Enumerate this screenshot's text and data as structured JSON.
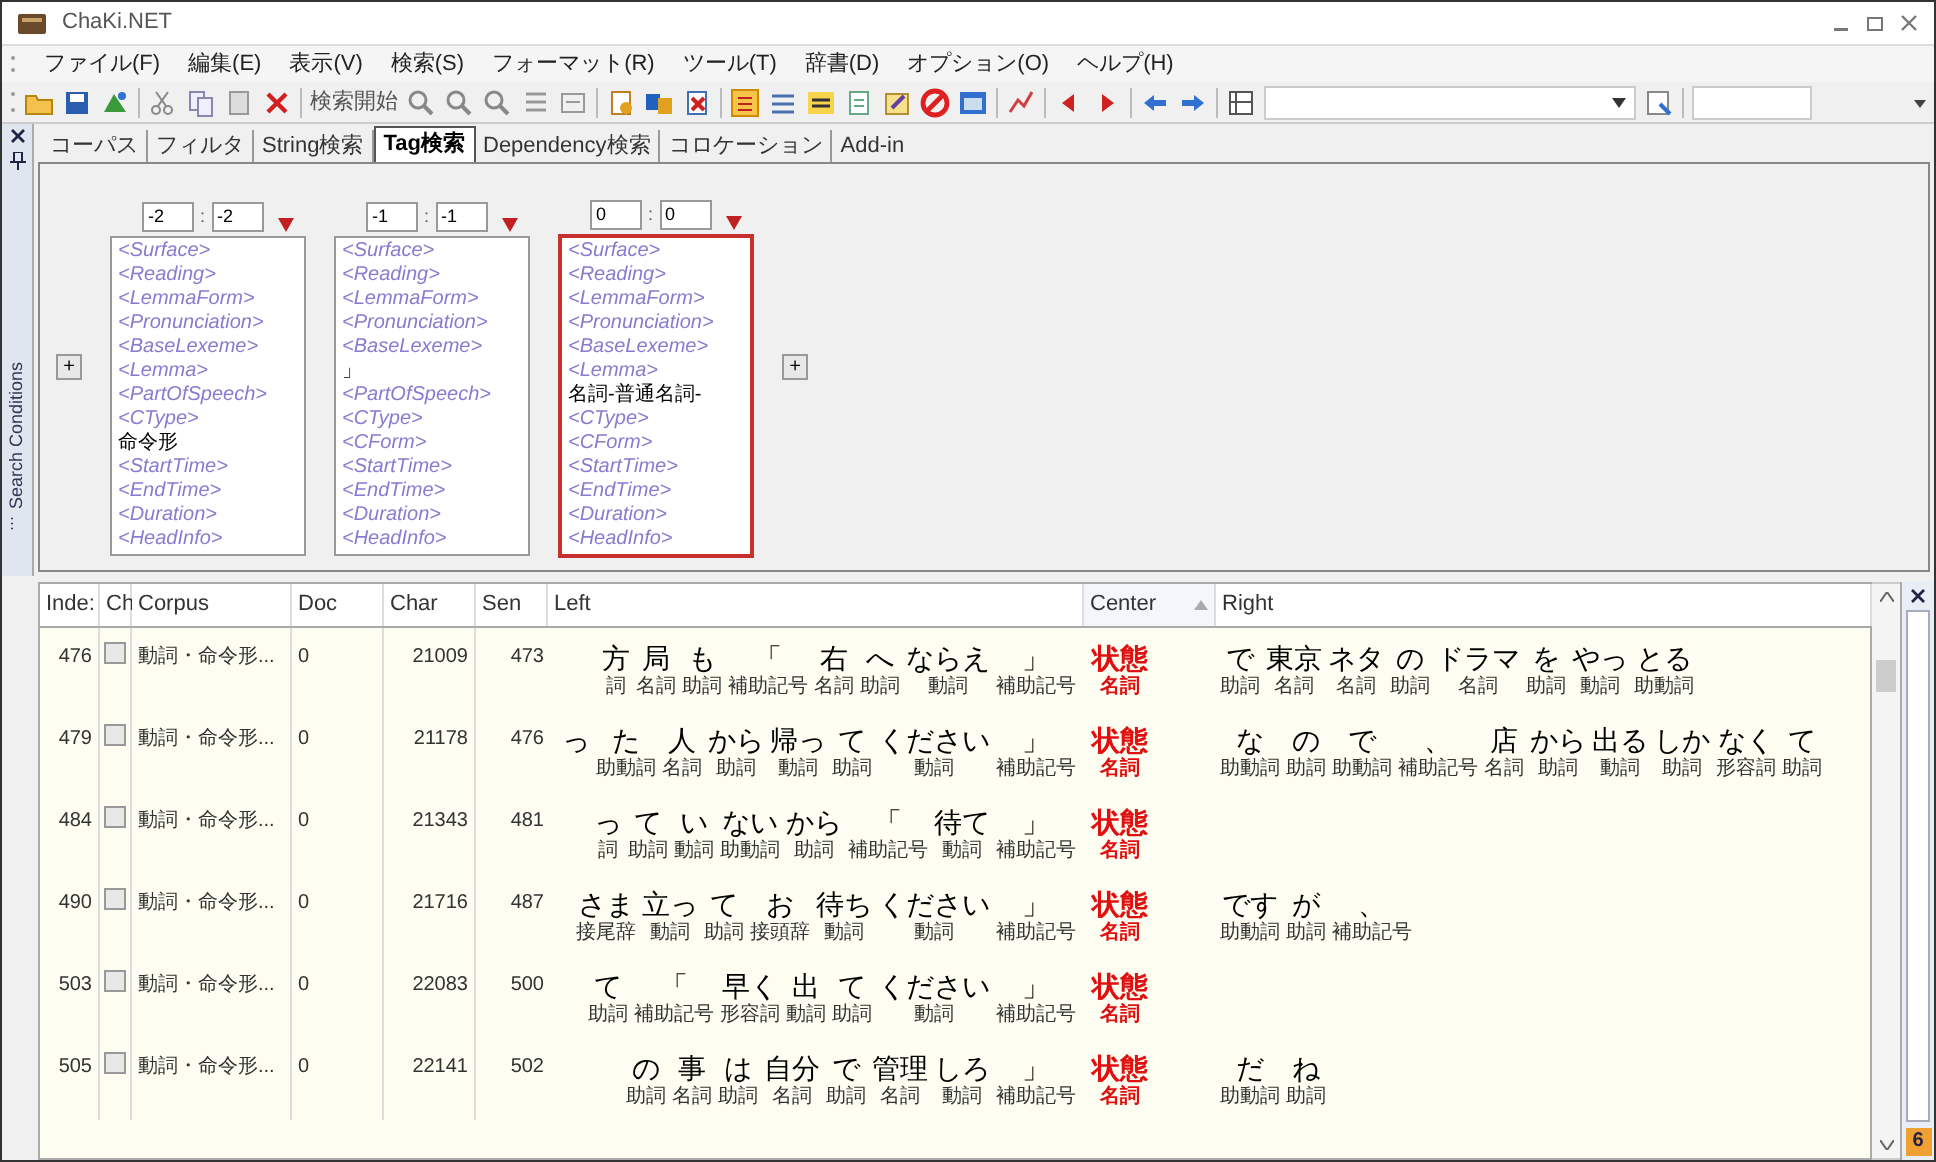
{
  "window": {
    "title": "ChaKi.NET"
  },
  "menu": [
    "ファイル(F)",
    "編集(E)",
    "表示(V)",
    "検索(S)",
    "フォーマット(R)",
    "ツール(T)",
    "辞書(D)",
    "オプション(O)",
    "ヘルプ(H)"
  ],
  "toolbar": {
    "search_button": "検索開始"
  },
  "side_tab": {
    "label": "Search Conditions",
    "more": "..."
  },
  "tabs": [
    {
      "label": "コーパス",
      "selected": false
    },
    {
      "label": "フィルタ",
      "selected": false
    },
    {
      "label": "String検索",
      "selected": false
    },
    {
      "label": "Tag検索",
      "selected": true
    },
    {
      "label": "Dependency検索",
      "selected": false
    },
    {
      "label": "コロケーション",
      "selected": false
    },
    {
      "label": "Add-in",
      "selected": false
    }
  ],
  "search_conditions": {
    "add_button": "+",
    "boxes": [
      {
        "range_from": "-2",
        "separator": ":",
        "range_to": "-2",
        "selected": false,
        "fields": [
          {
            "placeholder": "<Surface>"
          },
          {
            "placeholder": "<Reading>"
          },
          {
            "placeholder": "<LemmaForm>"
          },
          {
            "placeholder": "<Pronunciation>"
          },
          {
            "placeholder": "<BaseLexeme>"
          },
          {
            "placeholder": "<Lemma>"
          },
          {
            "placeholder": "<PartOfSpeech>"
          },
          {
            "placeholder": "<CType>"
          },
          {
            "value": "命令形"
          },
          {
            "placeholder": "<StartTime>"
          },
          {
            "placeholder": "<EndTime>"
          },
          {
            "placeholder": "<Duration>"
          },
          {
            "placeholder": "<HeadInfo>"
          }
        ]
      },
      {
        "range_from": "-1",
        "separator": ":",
        "range_to": "-1",
        "selected": false,
        "fields": [
          {
            "placeholder": "<Surface>"
          },
          {
            "placeholder": "<Reading>"
          },
          {
            "placeholder": "<LemmaForm>"
          },
          {
            "placeholder": "<Pronunciation>"
          },
          {
            "placeholder": "<BaseLexeme>"
          },
          {
            "value": "」"
          },
          {
            "placeholder": "<PartOfSpeech>"
          },
          {
            "placeholder": "<CType>"
          },
          {
            "placeholder": "<CForm>"
          },
          {
            "placeholder": "<StartTime>"
          },
          {
            "placeholder": "<EndTime>"
          },
          {
            "placeholder": "<Duration>"
          },
          {
            "placeholder": "<HeadInfo>"
          }
        ]
      },
      {
        "range_from": "0",
        "separator": ":",
        "range_to": "0",
        "selected": true,
        "fields": [
          {
            "placeholder": "<Surface>"
          },
          {
            "placeholder": "<Reading>"
          },
          {
            "placeholder": "<LemmaForm>"
          },
          {
            "placeholder": "<Pronunciation>"
          },
          {
            "placeholder": "<BaseLexeme>"
          },
          {
            "placeholder": "<Lemma>"
          },
          {
            "value": "名詞-普通名詞-"
          },
          {
            "placeholder": "<CType>"
          },
          {
            "placeholder": "<CForm>"
          },
          {
            "placeholder": "<StartTime>"
          },
          {
            "placeholder": "<EndTime>"
          },
          {
            "placeholder": "<Duration>"
          },
          {
            "placeholder": "<HeadInfo>"
          }
        ]
      }
    ]
  },
  "results": {
    "columns": [
      {
        "label": "Inde:",
        "sorted": false
      },
      {
        "label": "Ch",
        "sorted": false
      },
      {
        "label": "Corpus",
        "sorted": false
      },
      {
        "label": "Doc",
        "sorted": false
      },
      {
        "label": "Char",
        "sorted": false
      },
      {
        "label": "Sen",
        "sorted": false
      },
      {
        "label": "Left",
        "sorted": false
      },
      {
        "label": "Center",
        "sorted": true
      },
      {
        "label": "Right",
        "sorted": false
      }
    ],
    "rows": [
      {
        "index": "476",
        "checked": false,
        "corpus": "動詞・命令形...",
        "doc": "0",
        "char": "21009",
        "sen": "473",
        "left": [
          {
            "surface": "方",
            "pos": "詞"
          },
          {
            "surface": "局",
            "pos": "名詞"
          },
          {
            "surface": "も",
            "pos": "助詞"
          },
          {
            "surface": "「",
            "pos": "補助記号"
          },
          {
            "surface": "右",
            "pos": "名詞"
          },
          {
            "surface": "へ",
            "pos": "助詞"
          },
          {
            "surface": "ならえ",
            "pos": "動詞"
          },
          {
            "surface": "」",
            "pos": "補助記号"
          }
        ],
        "center": {
          "surface": "状態",
          "pos": "名詞"
        },
        "right": [
          {
            "surface": "で",
            "pos": "助詞"
          },
          {
            "surface": "東京",
            "pos": "名詞"
          },
          {
            "surface": "ネタ",
            "pos": "名詞"
          },
          {
            "surface": "の",
            "pos": "助詞"
          },
          {
            "surface": "ドラマ",
            "pos": "名詞"
          },
          {
            "surface": "を",
            "pos": "助詞"
          },
          {
            "surface": "やっ",
            "pos": "動詞"
          },
          {
            "surface": "とる",
            "pos": "助動詞"
          }
        ]
      },
      {
        "index": "479",
        "checked": false,
        "corpus": "動詞・命令形...",
        "doc": "0",
        "char": "21178",
        "sen": "476",
        "left": [
          {
            "surface": "っ"
          },
          {
            "surface": "た",
            "pos": "助動詞"
          },
          {
            "surface": "人",
            "pos": "名詞"
          },
          {
            "surface": "から",
            "pos": "助詞"
          },
          {
            "surface": "帰っ",
            "pos": "動詞"
          },
          {
            "surface": "て",
            "pos": "助詞"
          },
          {
            "surface": "ください",
            "pos": "動詞"
          },
          {
            "surface": "」",
            "pos": "補助記号"
          }
        ],
        "center": {
          "surface": "状態",
          "pos": "名詞"
        },
        "right": [
          {
            "surface": "な",
            "pos": "助動詞"
          },
          {
            "surface": "の",
            "pos": "助詞"
          },
          {
            "surface": "で",
            "pos": "助動詞"
          },
          {
            "surface": "、",
            "pos": "補助記号"
          },
          {
            "surface": "店",
            "pos": "名詞"
          },
          {
            "surface": "から",
            "pos": "助詞"
          },
          {
            "surface": "出る",
            "pos": "動詞"
          },
          {
            "surface": "しか",
            "pos": "助詞"
          },
          {
            "surface": "なく",
            "pos": "形容詞"
          },
          {
            "surface": "て",
            "pos": "助詞"
          }
        ]
      },
      {
        "index": "484",
        "checked": false,
        "corpus": "動詞・命令形...",
        "doc": "0",
        "char": "21343",
        "sen": "481",
        "left": [
          {
            "surface": "っ",
            "pos": "詞"
          },
          {
            "surface": "て",
            "pos": "助詞"
          },
          {
            "surface": "い",
            "pos": "動詞"
          },
          {
            "surface": "ない",
            "pos": "助動詞"
          },
          {
            "surface": "から",
            "pos": "助詞"
          },
          {
            "surface": "「",
            "pos": "補助記号"
          },
          {
            "surface": "待て",
            "pos": "動詞"
          },
          {
            "surface": "」",
            "pos": "補助記号"
          }
        ],
        "center": {
          "surface": "状態",
          "pos": "名詞"
        },
        "right": []
      },
      {
        "index": "490",
        "checked": false,
        "corpus": "動詞・命令形...",
        "doc": "0",
        "char": "21716",
        "sen": "487",
        "left": [
          {
            "surface": "さま",
            "pos": "接尾辞"
          },
          {
            "surface": "立っ",
            "pos": "動詞"
          },
          {
            "surface": "て",
            "pos": "助詞"
          },
          {
            "surface": "お",
            "pos": "接頭辞"
          },
          {
            "surface": "待ち",
            "pos": "動詞"
          },
          {
            "surface": "ください",
            "pos": "動詞"
          },
          {
            "surface": "」",
            "pos": "補助記号"
          }
        ],
        "center": {
          "surface": "状態",
          "pos": "名詞"
        },
        "right": [
          {
            "surface": "です",
            "pos": "助動詞"
          },
          {
            "surface": "が",
            "pos": "助詞"
          },
          {
            "surface": "、",
            "pos": "補助記号"
          }
        ]
      },
      {
        "index": "503",
        "checked": false,
        "corpus": "動詞・命令形...",
        "doc": "0",
        "char": "22083",
        "sen": "500",
        "left": [
          {
            "surface": "て",
            "pos": "助詞"
          },
          {
            "surface": "「",
            "pos": "補助記号"
          },
          {
            "surface": "早く",
            "pos": "形容詞"
          },
          {
            "surface": "出",
            "pos": "動詞"
          },
          {
            "surface": "て",
            "pos": "助詞"
          },
          {
            "surface": "ください",
            "pos": "動詞"
          },
          {
            "surface": "」",
            "pos": "補助記号"
          }
        ],
        "center": {
          "surface": "状態",
          "pos": "名詞"
        },
        "right": []
      },
      {
        "index": "505",
        "checked": false,
        "corpus": "動詞・命令形...",
        "doc": "0",
        "char": "22141",
        "sen": "502",
        "left": [
          {
            "surface": "の",
            "pos": "助詞"
          },
          {
            "surface": "事",
            "pos": "名詞"
          },
          {
            "surface": "は",
            "pos": "助詞"
          },
          {
            "surface": "自分",
            "pos": "名詞"
          },
          {
            "surface": "で",
            "pos": "助詞"
          },
          {
            "surface": "管理",
            "pos": "名詞"
          },
          {
            "surface": "しろ",
            "pos": "動詞"
          },
          {
            "surface": "」",
            "pos": "補助記号"
          }
        ],
        "center": {
          "surface": "状態",
          "pos": "名詞"
        },
        "right": [
          {
            "surface": "だ",
            "pos": "助動詞"
          },
          {
            "surface": "ね",
            "pos": "助詞"
          }
        ]
      }
    ]
  },
  "side_panel": {
    "badge": "6"
  }
}
